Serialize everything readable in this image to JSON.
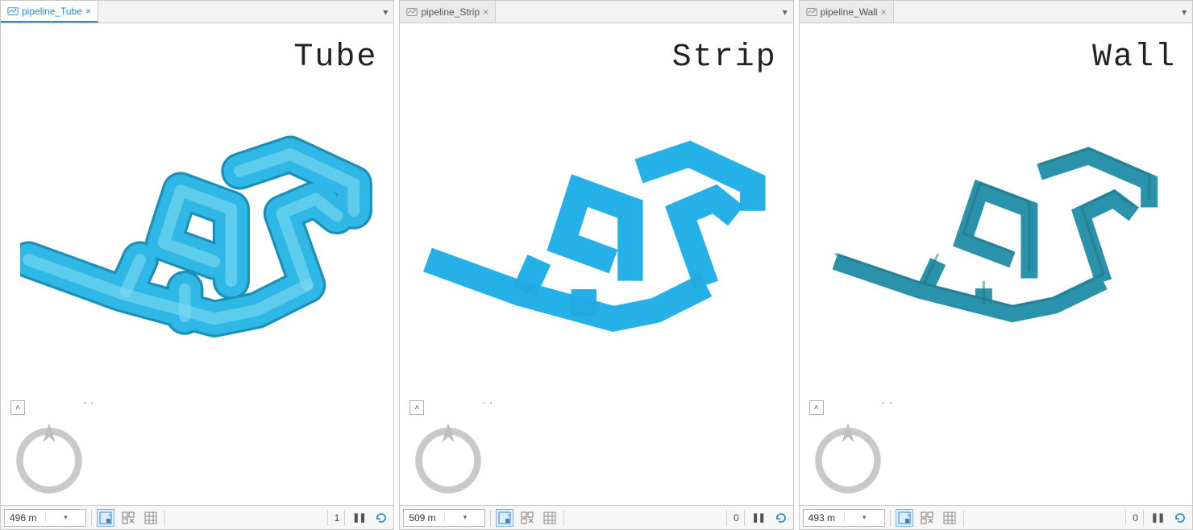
{
  "panes": [
    {
      "tab_label": "pipeline_Tube",
      "tab_active": true,
      "type_label": "Tube",
      "scale": "496 m",
      "count": "1",
      "fill": "#2fb8e6",
      "render": "tube"
    },
    {
      "tab_label": "pipeline_Strip",
      "tab_active": false,
      "type_label": "Strip",
      "scale": "509 m",
      "count": "0",
      "fill": "#29b6ef",
      "render": "strip"
    },
    {
      "tab_label": "pipeline_Wall",
      "tab_active": false,
      "type_label": "Wall",
      "scale": "493 m",
      "count": "0",
      "fill": "#2a93ab",
      "render": "wall"
    }
  ],
  "icons": {
    "close": "×",
    "dropdown": "▾",
    "collapse": "˄",
    "dots": "··"
  },
  "statusbar": {
    "pause_glyph": "❚❚"
  }
}
